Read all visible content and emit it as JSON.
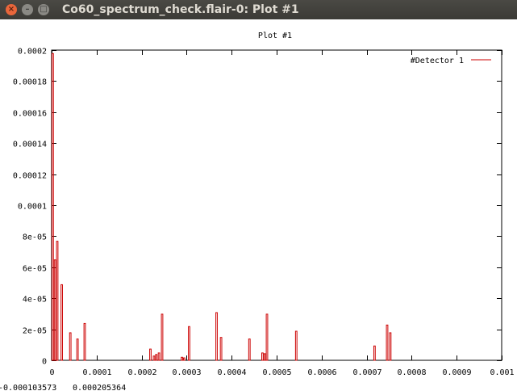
{
  "window": {
    "title": "Co60_spectrum_check.flair-0: Plot #1",
    "buttons": {
      "close": "×",
      "minimize": "–",
      "maximize": "□"
    }
  },
  "chart_data": {
    "type": "bar",
    "title": "Plot #1",
    "xlabel": "",
    "ylabel": "",
    "xlim": [
      0,
      0.001
    ],
    "ylim": [
      0,
      0.0002
    ],
    "x_ticks": [
      {
        "value": 0,
        "label": "0"
      },
      {
        "value": 0.0001,
        "label": "0.0001"
      },
      {
        "value": 0.0002,
        "label": "0.0002"
      },
      {
        "value": 0.0003,
        "label": "0.0003"
      },
      {
        "value": 0.0004,
        "label": "0.0004"
      },
      {
        "value": 0.0005,
        "label": "0.0005"
      },
      {
        "value": 0.0006,
        "label": "0.0006"
      },
      {
        "value": 0.0007,
        "label": "0.0007"
      },
      {
        "value": 0.0008,
        "label": "0.0008"
      },
      {
        "value": 0.0009,
        "label": "0.0009"
      },
      {
        "value": 0.001,
        "label": "0.001"
      }
    ],
    "y_ticks": [
      {
        "value": 0,
        "label": "0"
      },
      {
        "value": 2e-05,
        "label": "2e-05"
      },
      {
        "value": 4e-05,
        "label": "4e-05"
      },
      {
        "value": 6e-05,
        "label": "6e-05"
      },
      {
        "value": 8e-05,
        "label": "8e-05"
      },
      {
        "value": 0.0001,
        "label": "0.0001"
      },
      {
        "value": 0.00012,
        "label": "0.00012"
      },
      {
        "value": 0.00014,
        "label": "0.00014"
      },
      {
        "value": 0.00016,
        "label": "0.00016"
      },
      {
        "value": 0.00018,
        "label": "0.00018"
      },
      {
        "value": 0.0002,
        "label": "0.0002"
      }
    ],
    "legend": {
      "position": "top-right",
      "label": "#Detector 1"
    },
    "series": [
      {
        "name": "#Detector 1",
        "color": "#cc0000",
        "bars": [
          {
            "x0": 0.0,
            "x1": 5e-06,
            "y": 0.000198
          },
          {
            "x0": 5e-06,
            "x1": 1e-05,
            "y": 6.5e-05
          },
          {
            "x0": 1e-05,
            "x1": 1.5e-05,
            "y": 7.7e-05
          },
          {
            "x0": 2e-05,
            "x1": 2.5e-05,
            "y": 4.9e-05
          },
          {
            "x0": 3.9e-05,
            "x1": 4.4e-05,
            "y": 1.8e-05
          },
          {
            "x0": 5.5e-05,
            "x1": 6e-05,
            "y": 1.4e-05
          },
          {
            "x0": 7.1e-05,
            "x1": 7.6e-05,
            "y": 2.4e-05
          },
          {
            "x0": 0.000217,
            "x1": 0.000222,
            "y": 7.5e-06
          },
          {
            "x0": 0.000225,
            "x1": 0.00023,
            "y": 3e-06
          },
          {
            "x0": 0.00023,
            "x1": 0.000235,
            "y": 4e-06
          },
          {
            "x0": 0.000236,
            "x1": 0.000241,
            "y": 5e-06
          },
          {
            "x0": 0.000243,
            "x1": 0.000248,
            "y": 3e-05
          },
          {
            "x0": 0.000287,
            "x1": 0.000292,
            "y": 2.2e-06
          },
          {
            "x0": 0.000292,
            "x1": 0.000297,
            "y": 1.8e-06
          },
          {
            "x0": 0.000303,
            "x1": 0.000308,
            "y": 2.2e-05
          },
          {
            "x0": 0.000364,
            "x1": 0.000369,
            "y": 3.1e-05
          },
          {
            "x0": 0.000374,
            "x1": 0.000379,
            "y": 1.5e-05
          },
          {
            "x0": 0.000437,
            "x1": 0.000442,
            "y": 1.4e-05
          },
          {
            "x0": 0.000466,
            "x1": 0.000471,
            "y": 5e-06
          },
          {
            "x0": 0.000471,
            "x1": 0.000476,
            "y": 4.5e-06
          },
          {
            "x0": 0.000476,
            "x1": 0.000481,
            "y": 3e-05
          },
          {
            "x0": 0.000541,
            "x1": 0.000546,
            "y": 1.9e-05
          },
          {
            "x0": 0.000715,
            "x1": 0.00072,
            "y": 9.5e-06
          },
          {
            "x0": 0.000743,
            "x1": 0.000748,
            "y": 2.3e-05
          },
          {
            "x0": 0.00075,
            "x1": 0.000755,
            "y": 1.8e-05
          }
        ]
      }
    ],
    "grid": false
  },
  "status": {
    "coord_x": "-0.000103573",
    "coord_y": "0.000205364"
  }
}
